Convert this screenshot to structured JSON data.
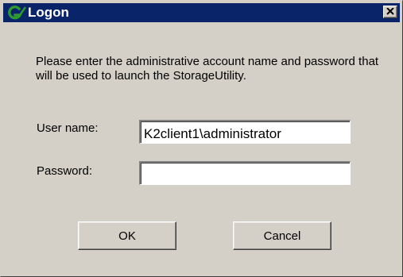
{
  "window": {
    "title": "Logon",
    "app_icon": "g-logo-icon",
    "close_icon": "close-icon",
    "close_label": "×"
  },
  "message": "Please enter the administrative account name and password that will be used to launch the StorageUtility.",
  "form": {
    "username_label": "User name:",
    "username_value": "K2client1\\administrator",
    "password_label": "Password:",
    "password_value": ""
  },
  "buttons": {
    "ok_label": "OK",
    "cancel_label": "Cancel"
  },
  "colors": {
    "titlebar": "#0a246a",
    "title_text": "#ffffff",
    "dialog_face": "#d4d0c8",
    "icon_green": "#2e9a2e"
  }
}
